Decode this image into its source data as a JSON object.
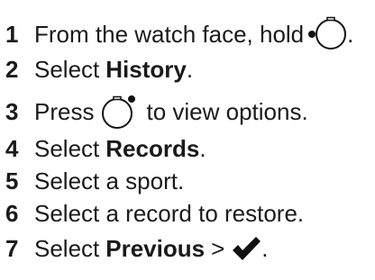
{
  "steps": [
    {
      "number": "1",
      "text_before": "From the watch face, hold",
      "icon": "watch-button-left-dot-icon",
      "text_after": "."
    },
    {
      "number": "2",
      "text_before": "Select",
      "bold": "History",
      "text_after": "."
    },
    {
      "number": "3",
      "text_before": "Press",
      "icon": "watch-button-top-right-dot-icon",
      "text_after": "to view options."
    },
    {
      "number": "4",
      "text_before": "Select",
      "bold": "Records",
      "text_after": "."
    },
    {
      "number": "5",
      "text": "Select a sport."
    },
    {
      "number": "6",
      "text": "Select a record to restore."
    },
    {
      "number": "7",
      "text_before": "Select",
      "bold": "Previous",
      "separator": ">",
      "icon": "checkmark-icon",
      "text_after": "."
    }
  ]
}
